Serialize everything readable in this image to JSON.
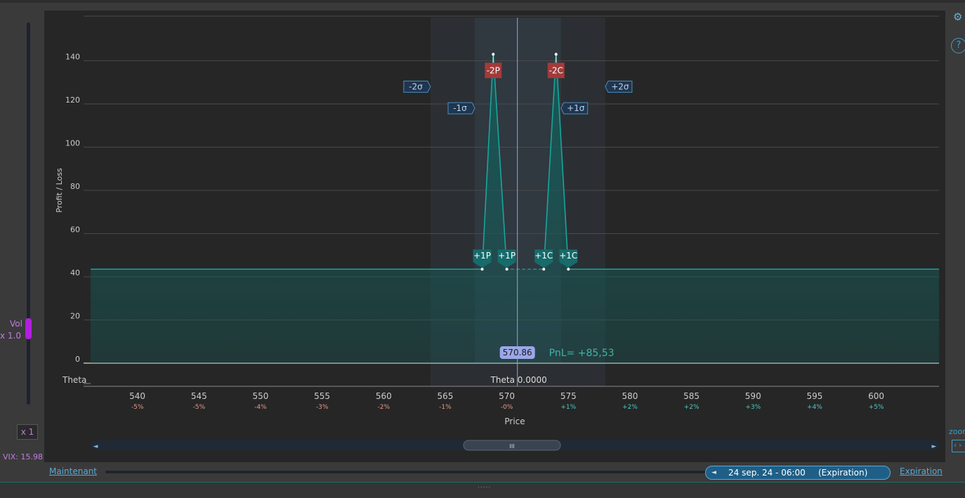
{
  "left_panel": {
    "vol_label": "Vol",
    "vol_multiplier": "x 1.0",
    "x1_button": "x 1",
    "vix": "VIX: 15.98",
    "vol_color": "#b21ee0"
  },
  "right_panel": {
    "settings_icon": "gear-icon",
    "help_label": "?",
    "zoom_label": "zoom",
    "zoom_button": "‹ ›"
  },
  "bottom_bar": {
    "now_link": "Maintenant",
    "time_arrow": "◄",
    "time_date": "24 sep. 24 - 06:00",
    "time_expiration": "(Expiration)",
    "expiration_link": "Expiration"
  },
  "footer": {
    "grip": "....."
  },
  "chart_data": {
    "type": "area",
    "ylabel": "Profit / Loss",
    "xlabel": "Price",
    "xlim": [
      536.2,
      605.1
    ],
    "ylim": [
      0,
      160
    ],
    "y_ticks": [
      0,
      20,
      40,
      60,
      80,
      100,
      120,
      140
    ],
    "x_ticks": [
      {
        "value": 540,
        "pct": "-5%"
      },
      {
        "value": 545,
        "pct": "-5%"
      },
      {
        "value": 550,
        "pct": "-4%"
      },
      {
        "value": 555,
        "pct": "-3%"
      },
      {
        "value": 560,
        "pct": "-2%"
      },
      {
        "value": 565,
        "pct": "-1%"
      },
      {
        "value": 570,
        "pct": "-0%"
      },
      {
        "value": 575,
        "pct": "+1%"
      },
      {
        "value": 580,
        "pct": "+2%"
      },
      {
        "value": 585,
        "pct": "+2%"
      },
      {
        "value": 590,
        "pct": "+3%"
      },
      {
        "value": 595,
        "pct": "+4%"
      },
      {
        "value": 600,
        "pct": "+5%"
      }
    ],
    "pnl_curve": [
      [
        536.2,
        43.5
      ],
      [
        568.0,
        43.5
      ],
      [
        568.9,
        143
      ],
      [
        570.0,
        43.5
      ],
      [
        573.0,
        43.5
      ],
      [
        574.0,
        143
      ],
      [
        575.0,
        43.5
      ],
      [
        605.1,
        43.5
      ]
    ],
    "legs": [
      {
        "label": "+1P",
        "x": 568.0,
        "y": 43.5,
        "type": "long"
      },
      {
        "label": "+1P",
        "x": 570.0,
        "y": 43.5,
        "type": "long"
      },
      {
        "label": "-2P",
        "x": 568.9,
        "y": 143,
        "type": "short"
      },
      {
        "label": "-2C",
        "x": 574.0,
        "y": 143,
        "type": "short"
      },
      {
        "label": "+1C",
        "x": 573.0,
        "y": 43.5,
        "type": "long"
      },
      {
        "label": "+1C",
        "x": 575.0,
        "y": 43.5,
        "type": "long"
      }
    ],
    "sigma_bands": [
      {
        "label": "-2σ",
        "x": 563.8,
        "y": 128
      },
      {
        "label": "-1σ",
        "x": 567.4,
        "y": 118
      },
      {
        "label": "+1σ",
        "x": 574.4,
        "y": 118
      },
      {
        "label": "+2σ",
        "x": 578.0,
        "y": 128
      }
    ],
    "current_price": 570.86,
    "current_price_label": "570.86",
    "pnl_label": "PnL= +85,53",
    "theta_row_label": "Theta",
    "theta_value_label": "Theta 0.0000",
    "scroll_grip": "III",
    "colors": {
      "curve": "#1aa39c",
      "fill": "#155a57",
      "short_leg": "#a33a3a",
      "long_leg": "#176b6b",
      "sigma": "#4a8fc0",
      "price_line": "#8fa6e0",
      "price_badge": "#9aa7e8",
      "pct_negative": "#e39a8c",
      "pct_positive": "#4ec9c2"
    }
  }
}
